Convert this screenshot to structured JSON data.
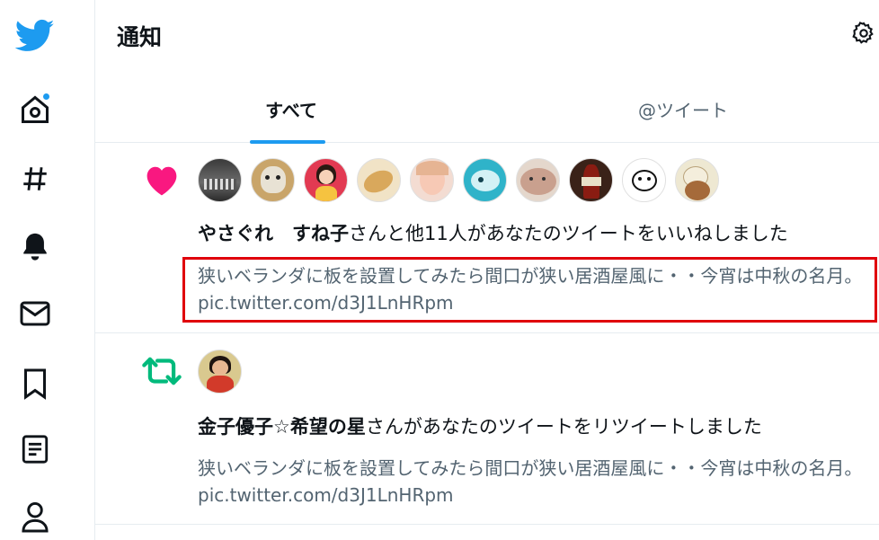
{
  "header": {
    "title": "通知"
  },
  "tabs": [
    {
      "label": "すべて",
      "active": true
    },
    {
      "label": "@ツイート",
      "active": false
    }
  ],
  "sidebar": {
    "items": [
      {
        "name": "twitter-logo"
      },
      {
        "name": "home",
        "has_dot": true
      },
      {
        "name": "explore"
      },
      {
        "name": "notifications"
      },
      {
        "name": "messages"
      },
      {
        "name": "bookmarks"
      },
      {
        "name": "lists"
      },
      {
        "name": "profile"
      }
    ]
  },
  "notifications": [
    {
      "type": "like",
      "icon": "heart-icon",
      "icon_color": "#f91880",
      "user_name": "やさぐれ　すね子",
      "action_text": "さんと他11人があなたのツイートをいいねしました",
      "tweet_text": "狭いベランダに板を設置してみたら間口が狭い居酒屋風に・・今宵は中秋の名月。 pic.twitter.com/d3J1LnHRpm",
      "avatar_count": 10
    },
    {
      "type": "retweet",
      "icon": "retweet-icon",
      "icon_color": "#00ba7c",
      "user_name": "金子優子☆希望の星",
      "action_text": "さんがあなたのツイートをリツイートしました",
      "tweet_text": "狭いベランダに板を設置してみたら間口が狭い居酒屋風に・・今宵は中秋の名月。 pic.twitter.com/d3J1LnHRpm",
      "avatar_count": 1
    }
  ],
  "colors": {
    "accent": "#1d9bf0",
    "highlight": "#e0000b",
    "secondary_text": "#536471"
  }
}
